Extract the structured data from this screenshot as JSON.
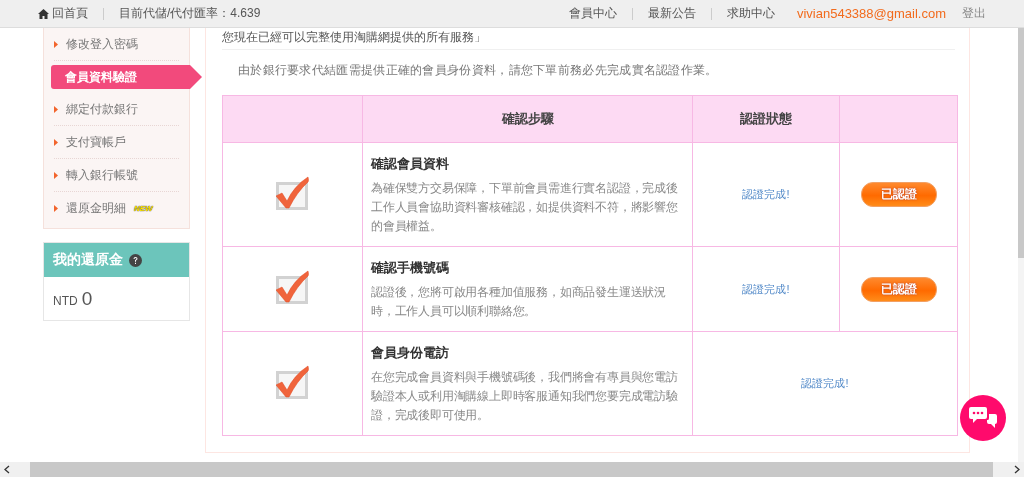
{
  "top_bar": {
    "home": "回首頁",
    "rate": "目前代儲/代付匯率：4.639",
    "links": [
      "會員中心",
      "最新公告",
      "求助中心"
    ],
    "email": "vivian543388@gmail.com",
    "logout": "登出"
  },
  "sidebar": {
    "items": [
      {
        "label": "修改登入密碼",
        "selected": false
      },
      {
        "label": "會員資料驗證",
        "selected": true
      },
      {
        "label": "綁定付款銀行",
        "selected": false
      },
      {
        "label": "支付寶帳戶",
        "selected": false
      },
      {
        "label": "轉入銀行帳號",
        "selected": false
      },
      {
        "label": "還原金明細",
        "selected": false,
        "badge": "NEW"
      }
    ],
    "wallet": {
      "title": "我的還原金",
      "currency": "NTD",
      "amount": "0"
    }
  },
  "notice": "您現在已經可以完整使用淘購網提供的所有服務」",
  "intro": "由於銀行要求代結匯需提供正確的會員身份資料，請您下單前務必先完成實名認證作業。",
  "table": {
    "columns": [
      "確認步驟",
      "認證狀態"
    ],
    "rows": [
      {
        "checked": true,
        "title": "確認會員資料",
        "description": "為確保雙方交易保障，下單前會員需進行實名認證，完成後工作人員會協助資料審核確認，如提供資料不符，將影響您的會員權益。",
        "status": "認證完成!",
        "action": "已認證"
      },
      {
        "checked": true,
        "title": "確認手機號碼",
        "description": "認證後，您將可啟用各種加值服務，如商品發生運送狀況時，工作人員可以順利聯絡您。",
        "status": "認證完成!",
        "action": "已認證"
      },
      {
        "checked": true,
        "title": "會員身份電訪",
        "description": "在您完成會員資料與手機號碼後，我們將會有專員與您電訪驗證本人或利用淘購線上即時客服通知我們您要完成電訪驗證，完成後即可使用。",
        "status": "認證完成!"
      }
    ]
  }
}
